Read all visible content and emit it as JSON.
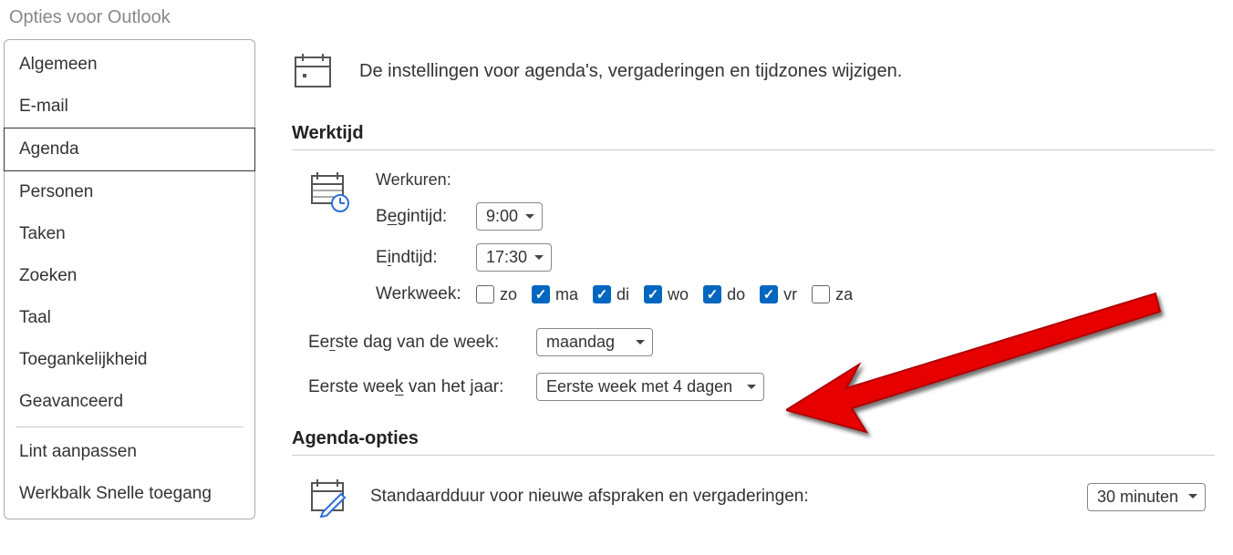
{
  "dialog_title": "Opties voor Outlook",
  "sidebar": {
    "items": [
      "Algemeen",
      "E-mail",
      "Agenda",
      "Personen",
      "Taken",
      "Zoeken",
      "Taal",
      "Toegankelijkheid",
      "Geavanceerd",
      "Lint aanpassen",
      "Werkbalk Snelle toegang"
    ],
    "selected_index": 2
  },
  "header": {
    "text": "De instellingen voor agenda's, vergaderingen en tijdzones wijzigen."
  },
  "werktijd": {
    "section_title": "Werktijd",
    "werkuren_label": "Werkuren:",
    "begintijd_label_pre": "B",
    "begintijd_label_u": "e",
    "begintijd_label_post": "gintijd:",
    "begintijd_value": "9:00",
    "eindtijd_label_pre": "E",
    "eindtijd_label_u": "i",
    "eindtijd_label_post": "ndtijd:",
    "eindtijd_value": "17:30",
    "werkweek_label": "Werkweek:",
    "days": [
      {
        "label": "zo",
        "checked": false
      },
      {
        "label": "ma",
        "checked": true
      },
      {
        "label": "di",
        "checked": true
      },
      {
        "label": "wo",
        "checked": true
      },
      {
        "label": "do",
        "checked": true
      },
      {
        "label": "vr",
        "checked": true
      },
      {
        "label": "za",
        "checked": false
      }
    ],
    "first_day_label_pre": "Ee",
    "first_day_label_u": "r",
    "first_day_label_post": "ste dag van de week:",
    "first_day_value": "maandag",
    "first_week_label_pre": "Eerste wee",
    "first_week_label_u": "k",
    "first_week_label_post": " van het jaar:",
    "first_week_value": "Eerste week met 4 dagen"
  },
  "agenda_opties": {
    "section_title": "Agenda-opties",
    "default_duration_label": "Standaardduur voor nieuwe afspraken en vergaderingen:",
    "default_duration_value": "30 minuten"
  }
}
